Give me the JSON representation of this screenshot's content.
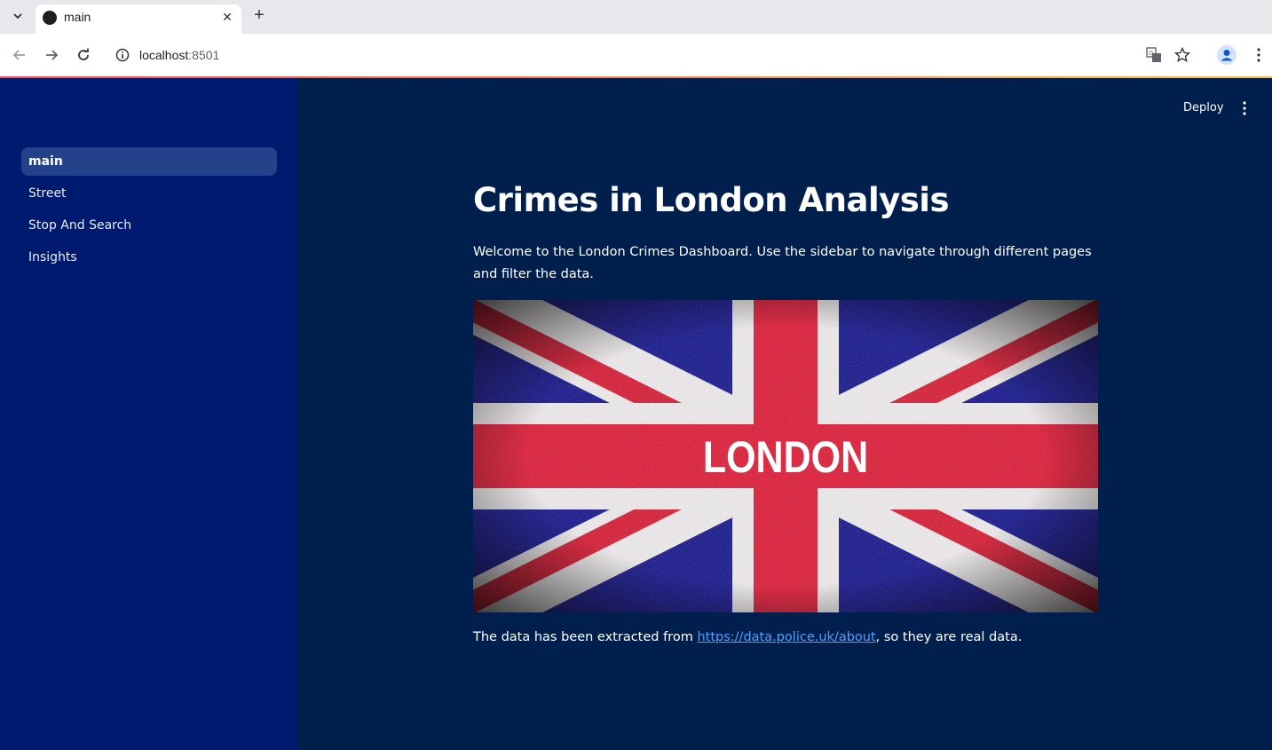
{
  "browser": {
    "tab_title": "main",
    "url_host": "localhost",
    "url_port": ":8501"
  },
  "sidebar": {
    "items": [
      {
        "label": "main",
        "active": true
      },
      {
        "label": "Street",
        "active": false
      },
      {
        "label": "Stop And Search",
        "active": false
      },
      {
        "label": "Insights",
        "active": false
      }
    ]
  },
  "header": {
    "deploy_label": "Deploy"
  },
  "content": {
    "title": "Crimes in London Analysis",
    "intro": "Welcome to the London Crimes Dashboard. Use the sidebar to navigate through different pages and filter the data.",
    "image_text": "LONDON",
    "footer_prefix": "The data has been extracted from ",
    "footer_link": "https://data.police.uk/about",
    "footer_suffix": ", so they are real data."
  },
  "colors": {
    "sidebar_bg": "#001a70",
    "main_bg": "#001f4d",
    "active_item_bg": "#24428a",
    "link": "#4aa0ff"
  }
}
